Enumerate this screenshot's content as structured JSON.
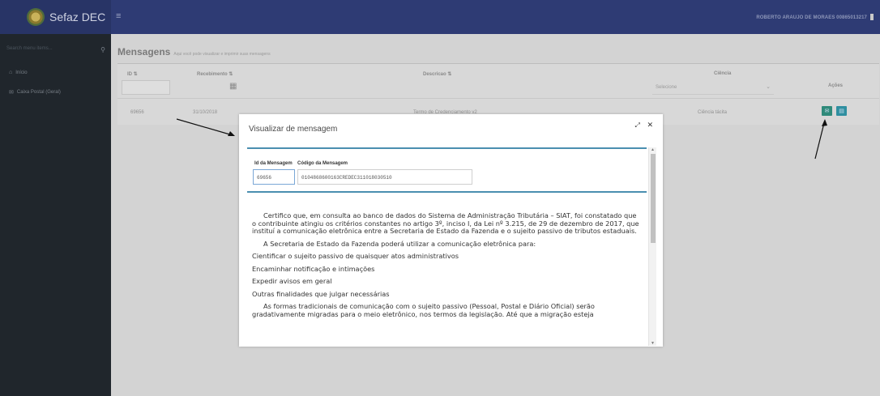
{
  "app": {
    "brand": "Sefaz DEC",
    "hamburger": "≡",
    "user": "ROBERTO ARAUJO DE MORAES 00865013217"
  },
  "sidebar": {
    "search_placeholder": "Search menu items...",
    "items": [
      {
        "label": "Início",
        "icon": "home-icon",
        "glyph": "⌂"
      },
      {
        "label": "Caixa Postal (Geral)",
        "icon": "mail-icon",
        "glyph": "✉"
      }
    ]
  },
  "page": {
    "title": "Mensagens",
    "subtitle": "Aqui você pode visualizar e imprimir suas mensagens"
  },
  "table": {
    "columns": {
      "id": "ID ⇅",
      "recebimento": "Recebimento ⇅",
      "descricao": "Descricao ⇅",
      "ciencia": "Ciência",
      "acoes": "Ações"
    },
    "ciencia_select": "Selecione",
    "rows": [
      {
        "id": "69656",
        "recebimento": "31/10/2018",
        "descricao": "Termo de Credenciamento v2",
        "ciencia": "Ciência tácita"
      }
    ]
  },
  "modal": {
    "title": "Visualizar de mensagem",
    "id_label": "Id da Mensagem",
    "id_value": "69656",
    "code_label": "Código da Mensagem",
    "code_value": "0104868600163CREDEC311018030510",
    "paragraphs": [
      "Certifico que, em consulta ao banco de dados do Sistema de Administração Tributária – SIAT, foi constatado que o contribuinte atingiu os critérios constantes no artigo 3º, inciso I, da Lei nº 3.215, de 29 de dezembro de 2017, que instituí a comunicação eletrônica entre a Secretaria de Estado da Fazenda e o sujeito passivo de tributos estaduais.",
      "A Secretaria de Estado da Fazenda poderá utilizar a comunicação eletrônica para:",
      "Cientificar o sujeito passivo de quaisquer atos administrativos",
      "Encaminhar notificação e intimações",
      "Expedir avisos em geral",
      "Outras finalidades que julgar necessárias",
      "As formas tradicionais de comunicação com o sujeito passivo (Pessoal, Postal e Diário Oficial) serão gradativamente migradas para o meio eletrônico, nos termos da legislação. Até que a migração esteja"
    ]
  },
  "colors": {
    "topbar": "#2e3b74",
    "sidebar": "#20262c",
    "accent": "#4a8fb0",
    "action_green": "#2f8a7a"
  }
}
